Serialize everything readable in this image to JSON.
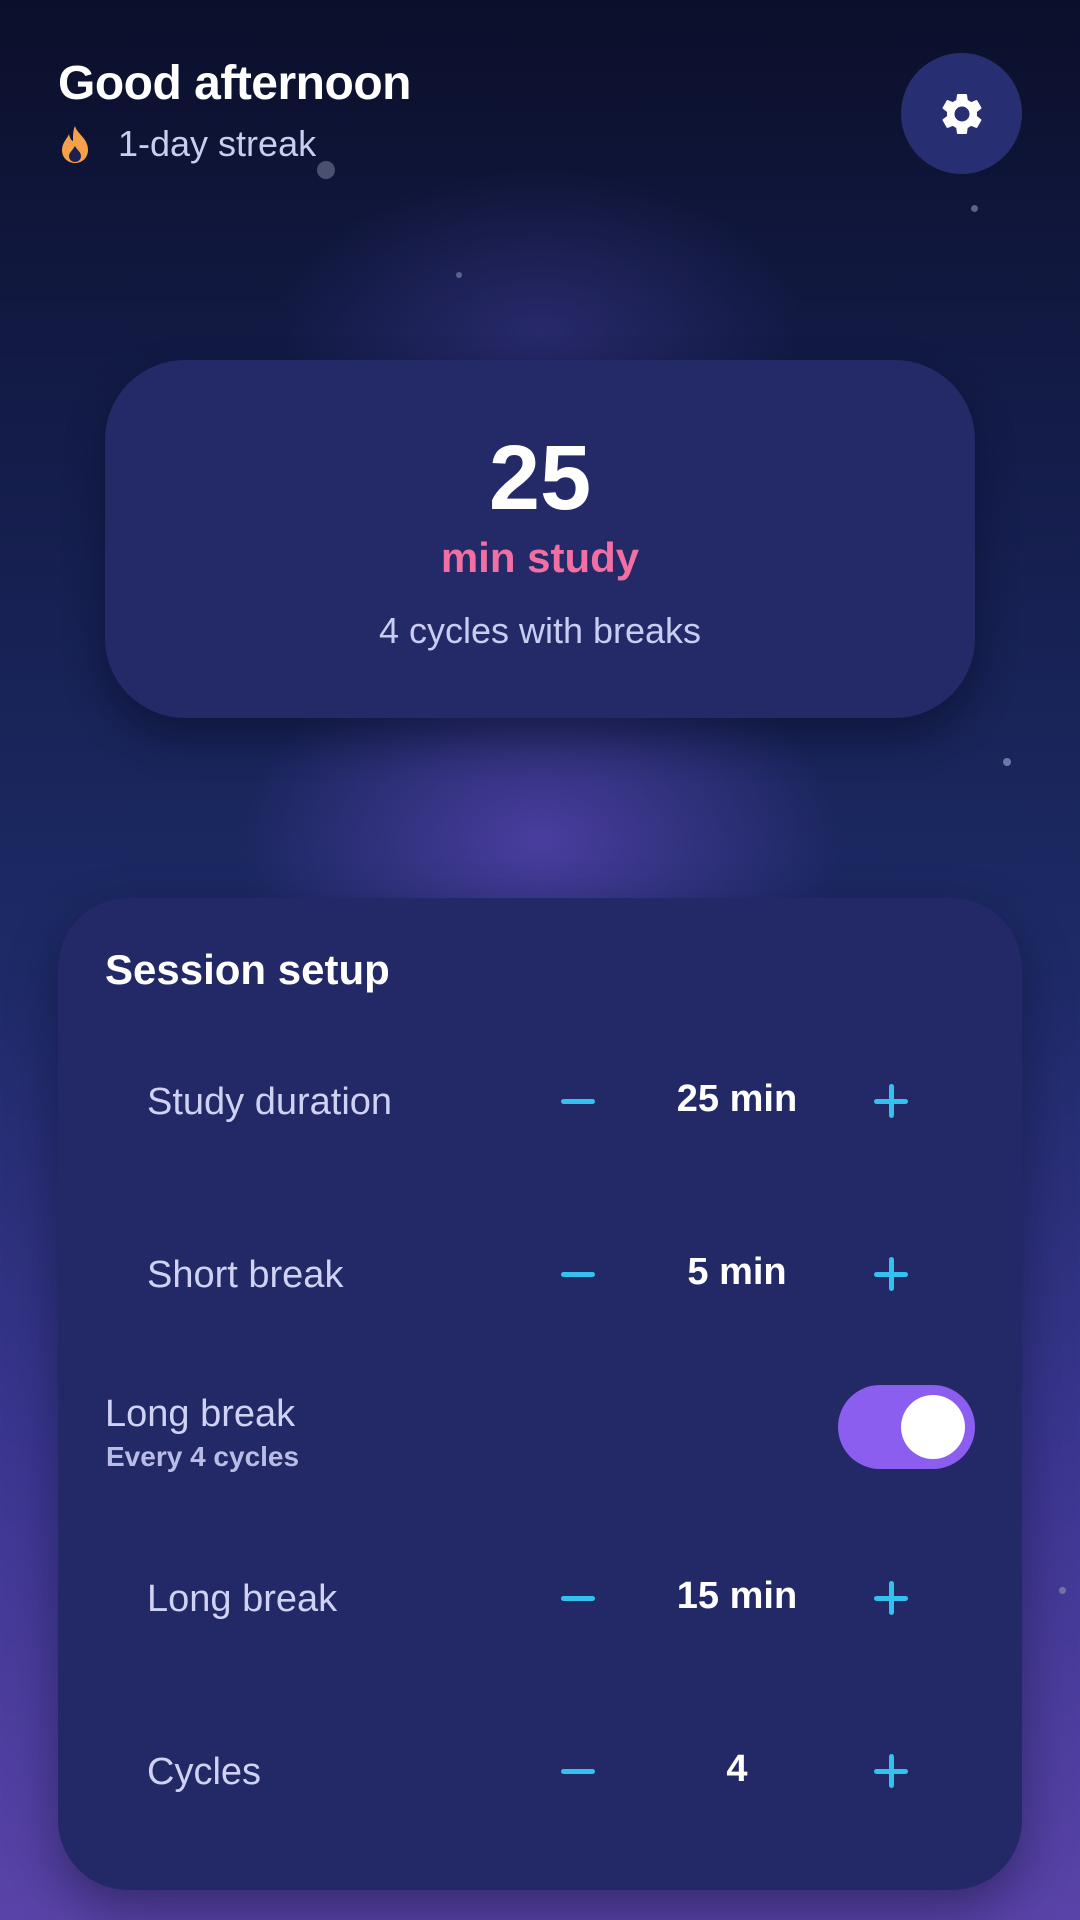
{
  "header": {
    "greeting": "Good afternoon",
    "streak_text": "1-day streak",
    "streak_icon": "flame-icon",
    "settings_icon": "gear-icon"
  },
  "hero": {
    "minutes": "25",
    "unit": "min study",
    "subtitle": "4 cycles with breaks"
  },
  "setup": {
    "title": "Session setup",
    "study": {
      "label": "Study duration",
      "value": "25 min"
    },
    "short_break": {
      "label": "Short break",
      "value": "5 min"
    },
    "long_break_toggle": {
      "title": "Long break",
      "subtitle": "Every 4 cycles",
      "enabled": true
    },
    "long_break": {
      "label": "Long break",
      "value": "15 min"
    },
    "cycles": {
      "label": "Cycles",
      "value": "4"
    }
  },
  "colors": {
    "accent_pink": "#f26fa3",
    "accent_cyan": "#35c1ef",
    "toggle_on": "#8c5ef0",
    "card_bg": "#232866",
    "flame": "#f7a04a"
  }
}
